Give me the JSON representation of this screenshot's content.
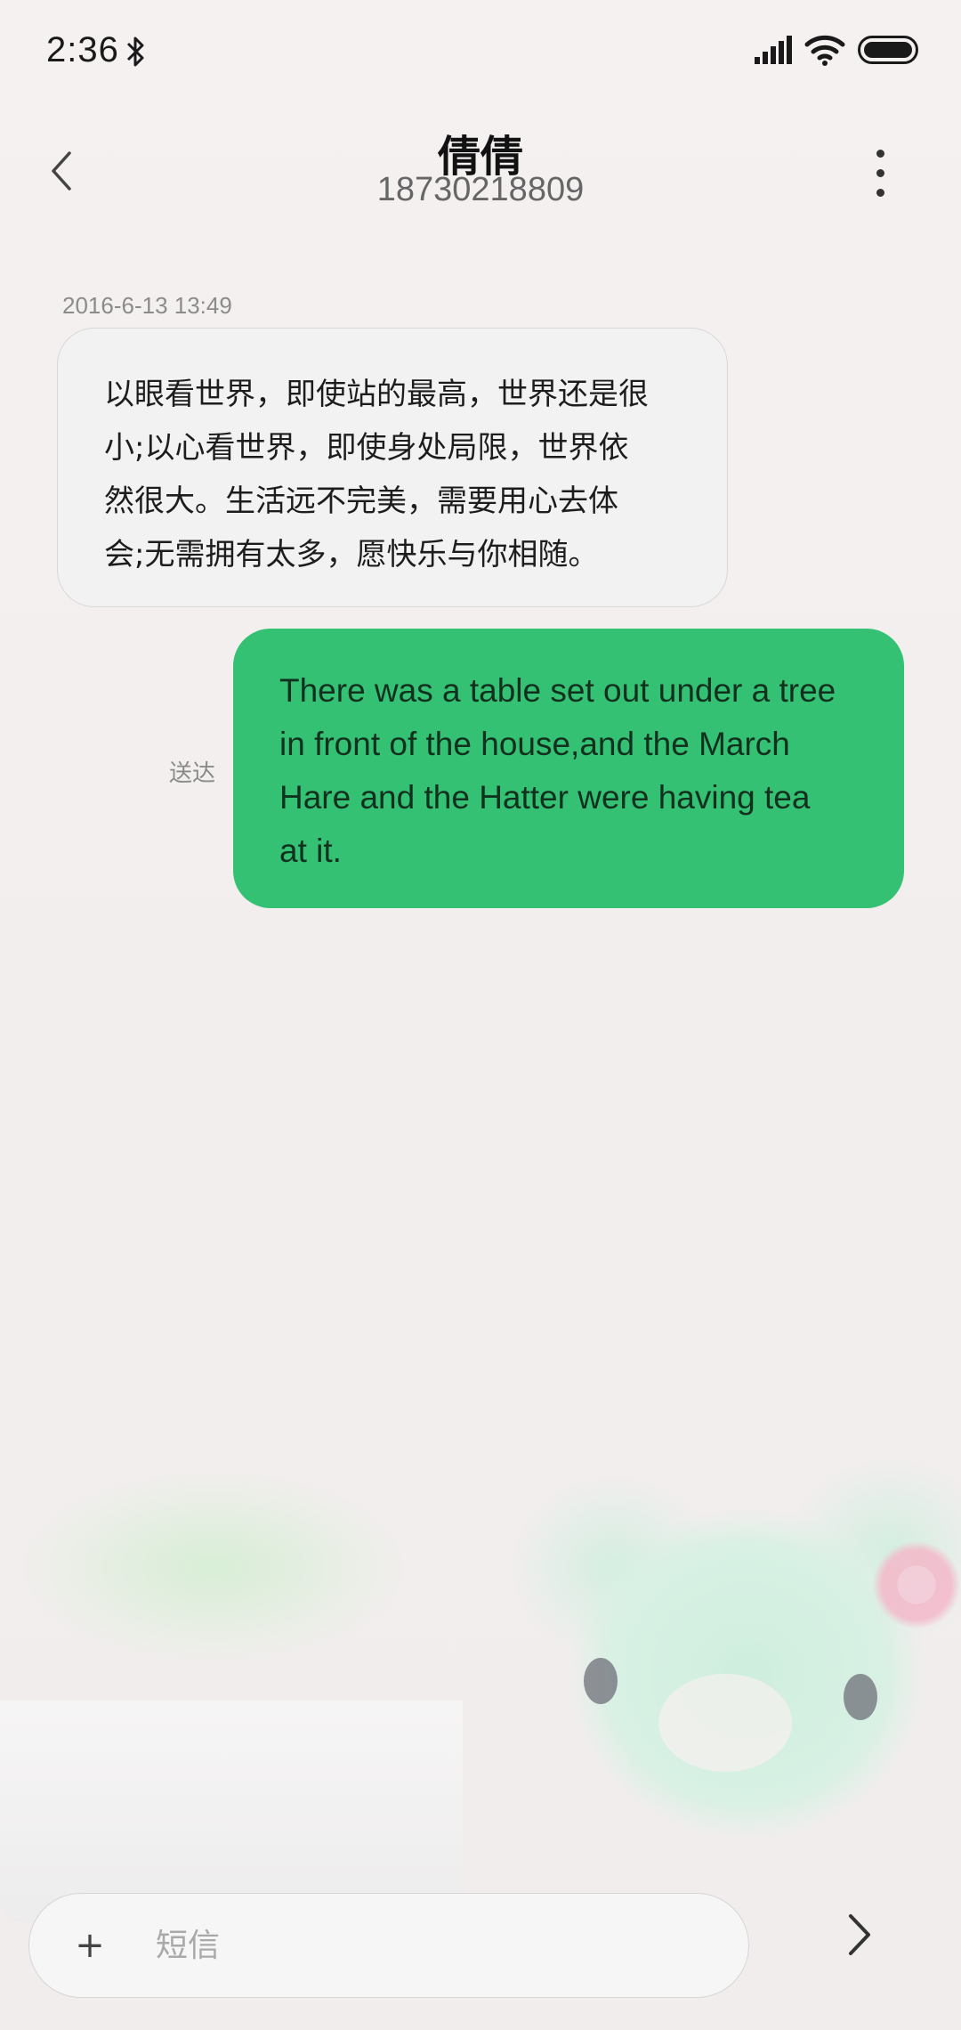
{
  "status_bar": {
    "time": "2:36",
    "icons": [
      "bluetooth-icon",
      "signal-icon",
      "wifi-icon",
      "battery-icon"
    ]
  },
  "header": {
    "contact_name": "倩倩",
    "phone_number": "18730218809",
    "icons": [
      "back-chevron-icon",
      "more-vertical-icon"
    ]
  },
  "conversation": {
    "timestamp": "2016-6-13 13:49",
    "incoming": {
      "lines": [
        "以眼看世界，即使站的最高，世界还是很",
        "小;以心看世界，即使身处局限，世界依",
        "然很大。生活远不完美，需要用心去体",
        "会;无需拥有太多，愿快乐与你相随。"
      ]
    },
    "outgoing": {
      "status": "送达",
      "lines": [
        "There was a table set out under a tree",
        "in front of the house,and the March",
        "Hare and the Hatter were having tea",
        "at it."
      ]
    }
  },
  "composer": {
    "plus_label": "+",
    "placeholder": "短信",
    "send_icon": "send-chevron-icon"
  },
  "colors": {
    "outgoing_bubble": "#35c173",
    "incoming_bubble": "#f2f2f2",
    "background": "#f3efef"
  }
}
